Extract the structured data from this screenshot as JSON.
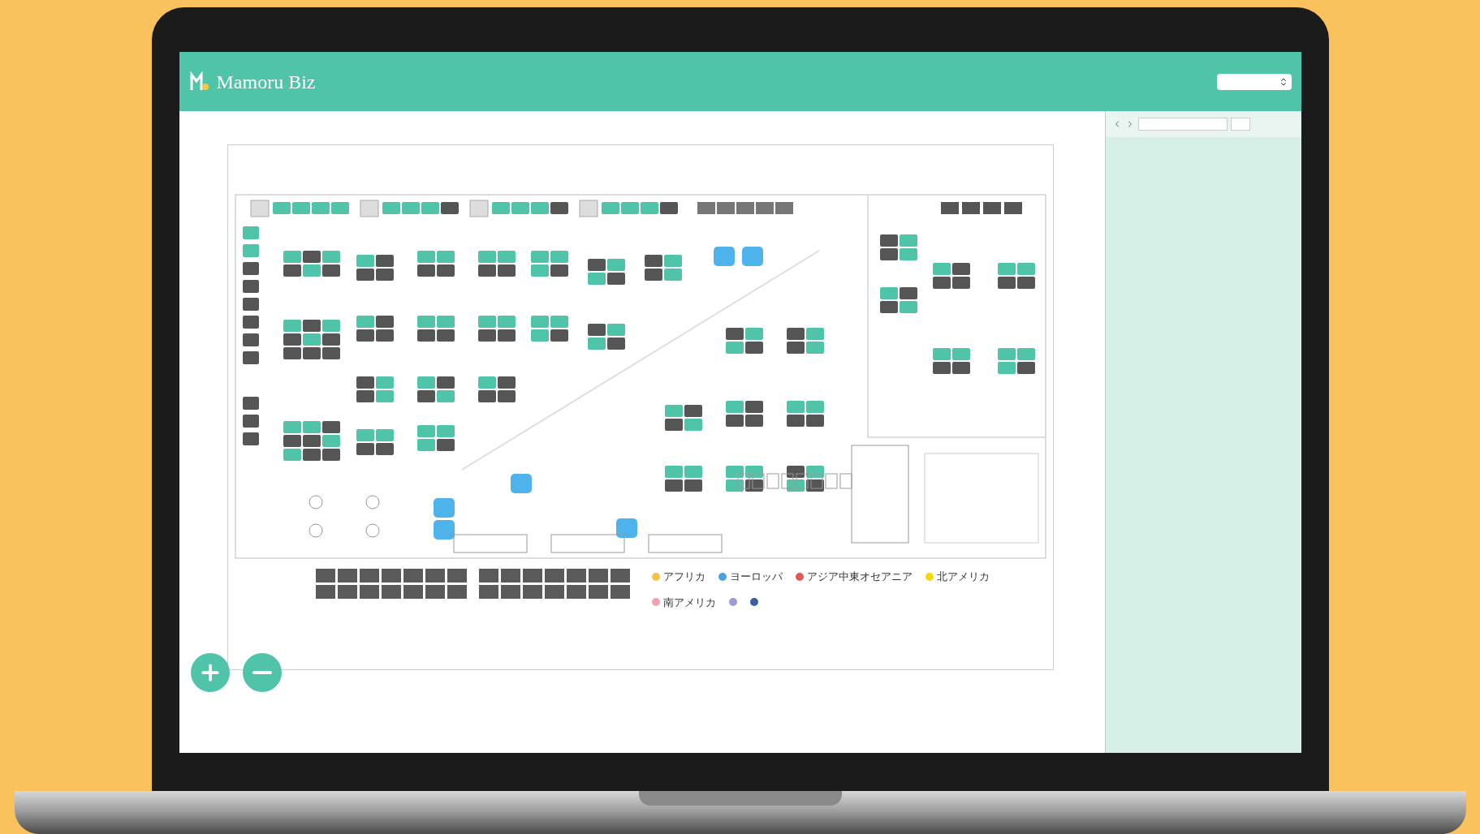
{
  "app": {
    "title": "Mamoru Biz"
  },
  "legend": [
    {
      "label": "アフリカ",
      "color": "#f2c14e"
    },
    {
      "label": "ヨーロッパ",
      "color": "#4aa3df"
    },
    {
      "label": "アジア中東オセアニア",
      "color": "#e05a5a"
    },
    {
      "label": "北アメリカ",
      "color": "#f5d90a"
    },
    {
      "label": "南アメリカ",
      "color": "#f0a0b0"
    },
    {
      "color": "#9b9bd6"
    },
    {
      "color": "#3a5fa0"
    }
  ]
}
